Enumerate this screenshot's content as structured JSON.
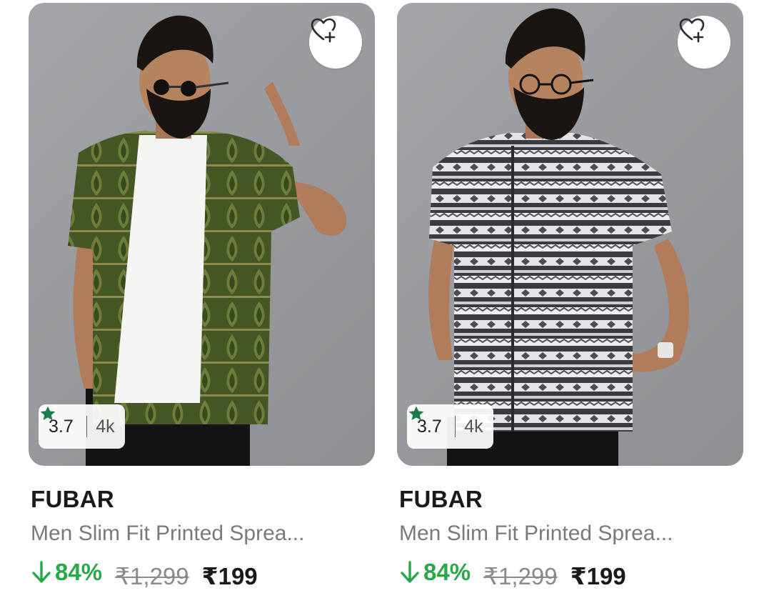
{
  "products": [
    {
      "rating": "3.7",
      "rating_count": "4k",
      "brand": "FUBAR",
      "title": "Men Slim Fit Printed Sprea...",
      "discount": "84%",
      "mrp": "₹1,299",
      "price": "₹199",
      "shirt_color": "#4a5a28",
      "image_desc_icon": "product-photo"
    },
    {
      "rating": "3.7",
      "rating_count": "4k",
      "brand": "FUBAR",
      "title": "Men Slim Fit Printed Sprea...",
      "discount": "84%",
      "mrp": "₹1,299",
      "price": "₹199",
      "shirt_color": "#3d3d44",
      "image_desc_icon": "product-photo"
    }
  ],
  "colors": {
    "discount_green": "#2aa849",
    "star_green": "#1d7a4a",
    "text_dark": "#1a1a1a",
    "text_muted": "#7a7a7a"
  },
  "icons": {
    "wishlist": "heart-plus-icon",
    "rating": "star-icon",
    "discount": "arrow-down-icon"
  }
}
